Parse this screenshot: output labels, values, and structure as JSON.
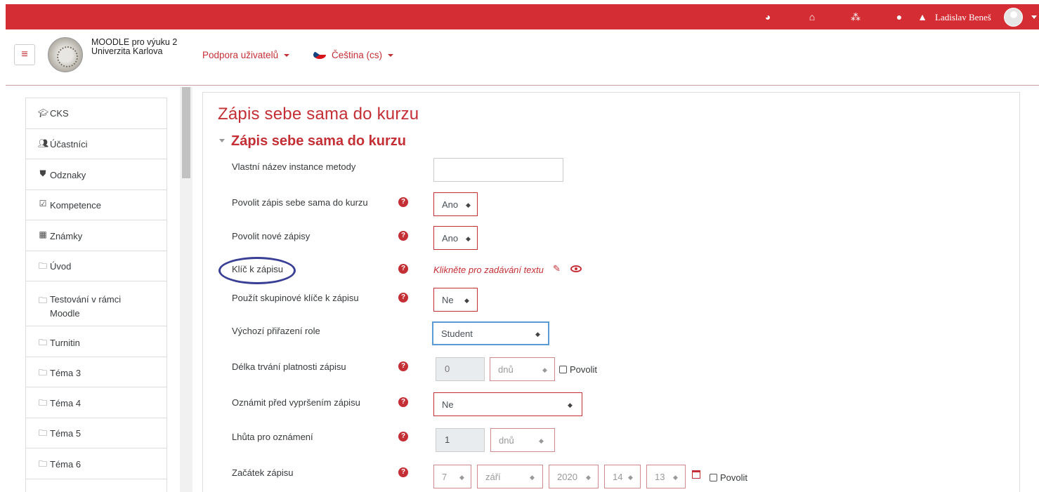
{
  "topbar": {
    "icons": [
      "dashboard-icon",
      "home-icon",
      "cubes-icon",
      "chat-icon",
      "bell-icon"
    ],
    "user_name": "Ladislav Beneš"
  },
  "navbar": {
    "site_line1": "MOODLE pro výuku 2",
    "site_line2": "Univerzita Karlova",
    "support_label": "Podpora uživatelů",
    "language_label": "Čeština (cs)"
  },
  "drawer": {
    "items": [
      {
        "icon": "graduation-cap-icon",
        "label": "CKS"
      },
      {
        "icon": "users-icon",
        "label": "Účastníci"
      },
      {
        "icon": "shield-icon",
        "label": "Odznaky"
      },
      {
        "icon": "checkbox-icon",
        "label": "Kompetence"
      },
      {
        "icon": "table-icon",
        "label": "Známky"
      },
      {
        "icon": "folder-icon",
        "label": "Úvod"
      },
      {
        "icon": "folder-icon",
        "label": "Testování v rámci Moodle"
      },
      {
        "icon": "folder-icon",
        "label": "Turnitin"
      },
      {
        "icon": "folder-icon",
        "label": "Téma 3"
      },
      {
        "icon": "folder-icon",
        "label": "Téma 4"
      },
      {
        "icon": "folder-icon",
        "label": "Téma 5"
      },
      {
        "icon": "folder-icon",
        "label": "Téma 6"
      }
    ]
  },
  "page": {
    "title": "Zápis sebe sama do kurzu",
    "section_title": "Zápis sebe sama do kurzu"
  },
  "form": {
    "instance_name": {
      "label": "Vlastní název instance metody",
      "value": ""
    },
    "allow_self_enrol": {
      "label": "Povolit zápis sebe sama do kurzu",
      "value": "Ano"
    },
    "allow_new": {
      "label": "Povolit nové zápisy",
      "value": "Ano"
    },
    "enrol_key": {
      "label": "Klíč k zápisu",
      "link": "Klikněte pro zadávání textu"
    },
    "group_keys": {
      "label": "Použít skupinové klíče k zápisu",
      "value": "Ne"
    },
    "default_role": {
      "label": "Výchozí přiřazení role",
      "value": "Student"
    },
    "duration": {
      "label": "Délka trvání platnosti zápisu",
      "value": "0",
      "unit": "dnů",
      "enable": "Povolit"
    },
    "notify": {
      "label": "Oznámit před vypršením zápisu",
      "value": "Ne"
    },
    "threshold": {
      "label": "Lhůta pro oznámení",
      "value": "1",
      "unit": "dnů"
    },
    "start": {
      "label": "Začátek zápisu",
      "day": "7",
      "month": "září",
      "year": "2020",
      "hour": "14",
      "minute": "13",
      "enable": "Povolit"
    }
  }
}
